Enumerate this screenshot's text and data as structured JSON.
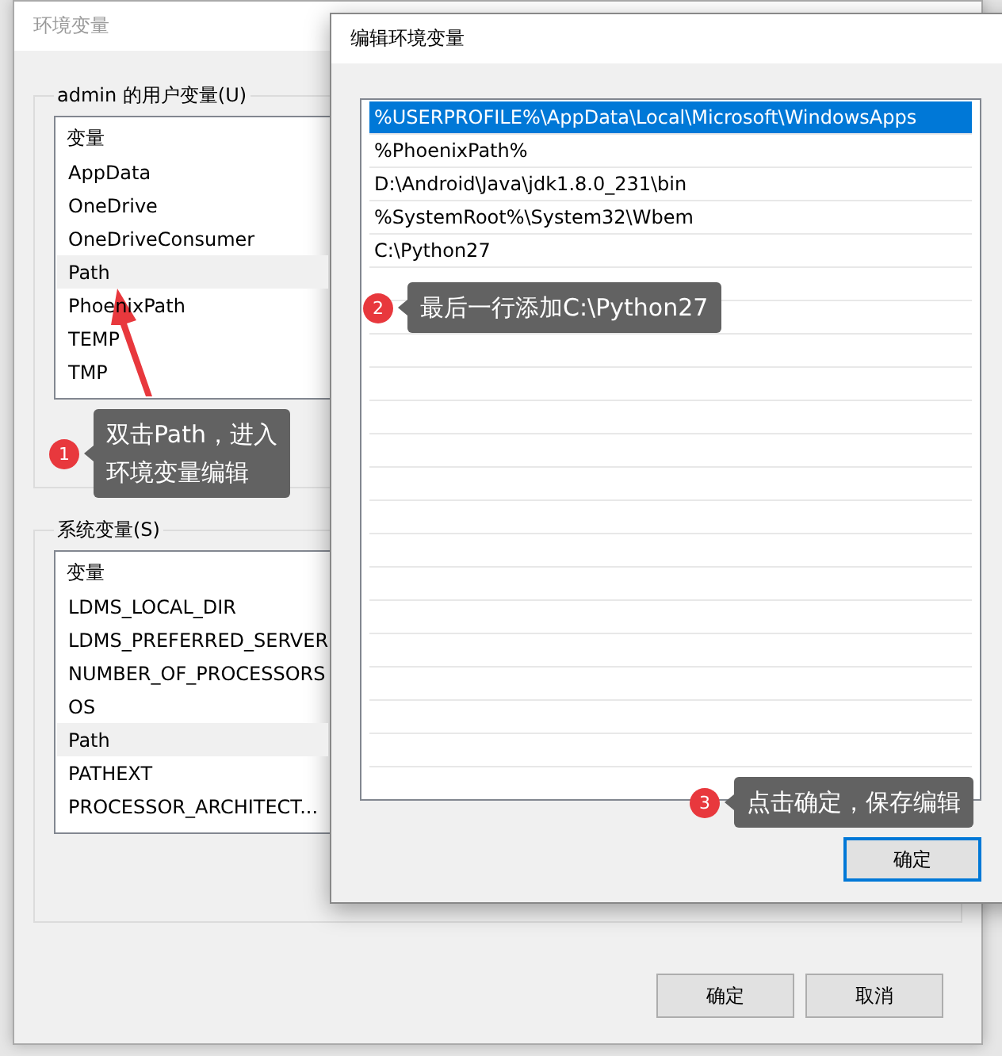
{
  "env_window": {
    "title": "环境变量",
    "user_vars": {
      "legend": "admin 的用户变量(U)",
      "header": "变量",
      "items": [
        {
          "label": "AppData",
          "selected": false
        },
        {
          "label": "OneDrive",
          "selected": false
        },
        {
          "label": "OneDriveConsumer",
          "selected": false
        },
        {
          "label": "Path",
          "selected": true
        },
        {
          "label": "PhoenixPath",
          "selected": false
        },
        {
          "label": "TEMP",
          "selected": false
        },
        {
          "label": "TMP",
          "selected": false
        }
      ]
    },
    "system_vars": {
      "legend": "系统变量(S)",
      "header": "变量",
      "items": [
        {
          "label": "LDMS_LOCAL_DIR",
          "selected": false
        },
        {
          "label": "LDMS_PREFERRED_SERVER",
          "selected": false
        },
        {
          "label": "NUMBER_OF_PROCESSORS",
          "selected": false
        },
        {
          "label": "OS",
          "selected": false
        },
        {
          "label": "Path",
          "selected": true
        },
        {
          "label": "PATHEXT",
          "selected": false
        },
        {
          "label": "PROCESSOR_ARCHITECT...",
          "selected": false
        }
      ]
    },
    "buttons": [
      "确定",
      "取消"
    ]
  },
  "edit_dialog": {
    "title": "编辑环境变量",
    "entries": [
      {
        "text": "%USERPROFILE%\\AppData\\Local\\Microsoft\\WindowsApps",
        "selected": true
      },
      {
        "text": "%PhoenixPath%",
        "selected": false
      },
      {
        "text": "D:\\Android\\Java\\jdk1.8.0_231\\bin",
        "selected": false
      },
      {
        "text": "%SystemRoot%\\System32\\Wbem",
        "selected": false
      },
      {
        "text": "C:\\Python27",
        "selected": false
      }
    ],
    "ok_button": "确定"
  },
  "callouts": [
    {
      "number": "1",
      "lines": [
        "双击Path，进入",
        "环境变量编辑"
      ]
    },
    {
      "number": "2",
      "lines": [
        "最后一行添加C:\\Python27"
      ]
    },
    {
      "number": "3",
      "lines": [
        "点击确定，保存编辑"
      ]
    }
  ]
}
